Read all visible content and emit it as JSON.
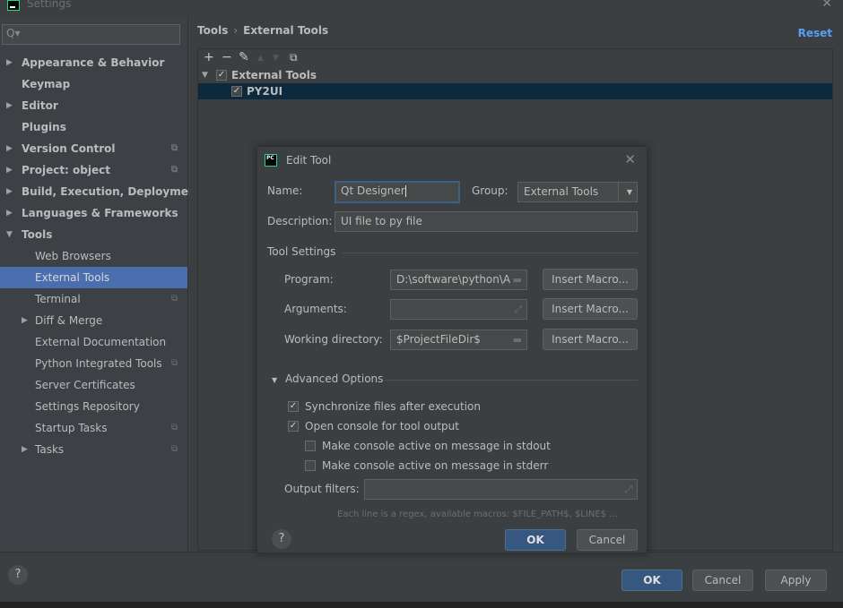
{
  "window": {
    "title": "Settings"
  },
  "sidebar": {
    "search_placeholder": "Q▾",
    "items": [
      {
        "label": "Appearance & Behavior",
        "arrow": "▶",
        "bold": true,
        "level": 0,
        "project": false
      },
      {
        "label": "Keymap",
        "arrow": "",
        "bold": true,
        "level": 0,
        "project": false
      },
      {
        "label": "Editor",
        "arrow": "▶",
        "bold": true,
        "level": 0,
        "project": false
      },
      {
        "label": "Plugins",
        "arrow": "",
        "bold": true,
        "level": 0,
        "project": false
      },
      {
        "label": "Version Control",
        "arrow": "▶",
        "bold": true,
        "level": 0,
        "project": true
      },
      {
        "label": "Project: object",
        "arrow": "▶",
        "bold": true,
        "level": 0,
        "project": true
      },
      {
        "label": "Build, Execution, Deployment",
        "arrow": "▶",
        "bold": true,
        "level": 0,
        "project": false
      },
      {
        "label": "Languages & Frameworks",
        "arrow": "▶",
        "bold": true,
        "level": 0,
        "project": false
      },
      {
        "label": "Tools",
        "arrow": "▼",
        "bold": true,
        "level": 0,
        "project": false
      },
      {
        "label": "Web Browsers",
        "arrow": "",
        "bold": false,
        "level": 1,
        "project": false
      },
      {
        "label": "External Tools",
        "arrow": "",
        "bold": false,
        "level": 1,
        "project": false,
        "selected": true
      },
      {
        "label": "Terminal",
        "arrow": "",
        "bold": false,
        "level": 1,
        "project": true
      },
      {
        "label": "Diff & Merge",
        "arrow": "▶",
        "bold": false,
        "level": 1,
        "project": false
      },
      {
        "label": "External Documentation",
        "arrow": "",
        "bold": false,
        "level": 1,
        "project": false
      },
      {
        "label": "Python Integrated Tools",
        "arrow": "",
        "bold": false,
        "level": 1,
        "project": true
      },
      {
        "label": "Server Certificates",
        "arrow": "",
        "bold": false,
        "level": 1,
        "project": false
      },
      {
        "label": "Settings Repository",
        "arrow": "",
        "bold": false,
        "level": 1,
        "project": false
      },
      {
        "label": "Startup Tasks",
        "arrow": "",
        "bold": false,
        "level": 1,
        "project": true
      },
      {
        "label": "Tasks",
        "arrow": "▶",
        "bold": false,
        "level": 1,
        "project": true
      }
    ],
    "project_icon": "⧉"
  },
  "main": {
    "breadcrumb": [
      "Tools",
      "External Tools"
    ],
    "breadcrumb_sep": "›",
    "reset_label": "Reset",
    "toolbar": {
      "add": "+",
      "remove": "−",
      "edit": "✎",
      "up": "▲",
      "down": "▼",
      "copy": "⧉"
    },
    "tree": [
      {
        "label": "External Tools",
        "checked": true,
        "expanded": true
      },
      {
        "label": "PY2UI",
        "checked": true,
        "selected": true
      }
    ]
  },
  "dialog": {
    "title": "Edit Tool",
    "icon_text": "PC",
    "name_label": "Name:",
    "name_value": "Qt Designer",
    "group_label": "Group:",
    "group_value": "External Tools",
    "description_label": "Description:",
    "description_value": "UI file to py file",
    "tool_settings_label": "Tool Settings",
    "program_label": "Program:",
    "program_value": "D:\\software\\python\\Ar",
    "arguments_label": "Arguments:",
    "arguments_value": "",
    "working_dir_label": "Working directory:",
    "working_dir_value": "$ProjectFileDir$",
    "insert_macro_label": "Insert Macro...",
    "advanced_label": "Advanced Options",
    "checkboxes": [
      {
        "label": "Synchronize files after execution",
        "checked": true
      },
      {
        "label": "Open console for tool output",
        "checked": true
      },
      {
        "label": "Make console active on message in stdout",
        "checked": false
      },
      {
        "label": "Make console active on message in stderr",
        "checked": false
      }
    ],
    "output_filters_label": "Output filters:",
    "output_filters_value": "",
    "hint": "Each line is a regex, available macros: $FILE_PATH$, $LINE$ ...",
    "ok_label": "OK",
    "cancel_label": "Cancel",
    "help_label": "?"
  },
  "footer": {
    "help_label": "?",
    "ok_label": "OK",
    "cancel_label": "Cancel",
    "apply_label": "Apply"
  }
}
